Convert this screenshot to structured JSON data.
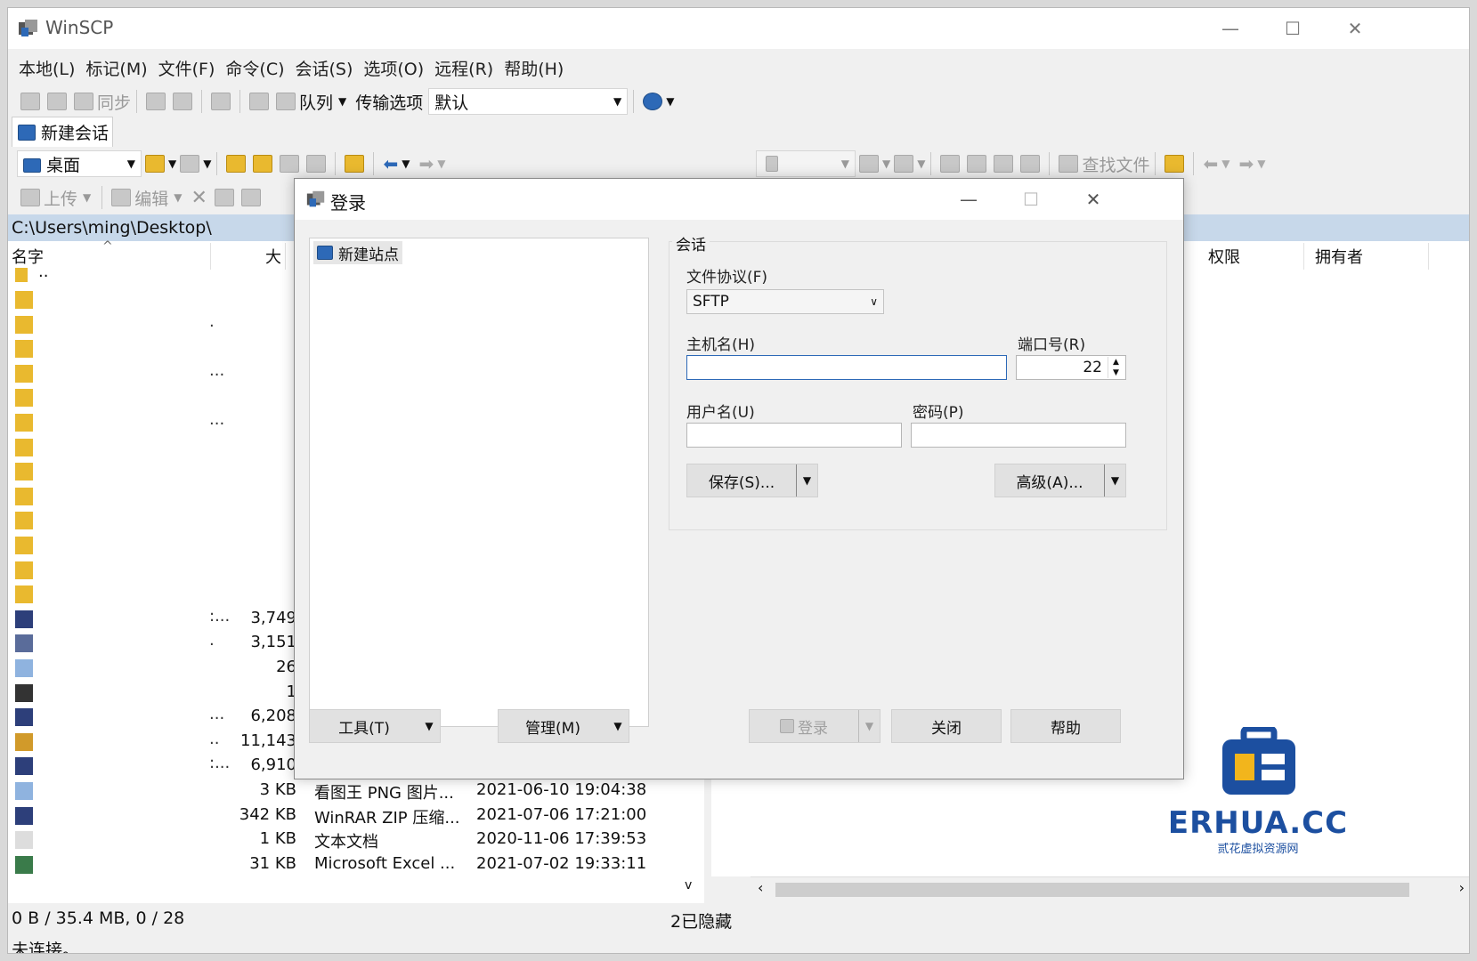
{
  "window": {
    "title": "WinSCP",
    "minimize": "—",
    "maximize": "☐",
    "close": "✕"
  },
  "menu": [
    "本地(L)",
    "标记(M)",
    "文件(F)",
    "命令(C)",
    "会话(S)",
    "选项(O)",
    "远程(R)",
    "帮助(H)"
  ],
  "toolbar": {
    "sync_label": "同步",
    "queue_label": "队列",
    "transfer_label": "传输选项",
    "transfer_value": "默认"
  },
  "tabs": {
    "new_session": "新建会话"
  },
  "local": {
    "location": "桌面",
    "upload_label": "上传",
    "edit_label": "编辑",
    "path": "C:\\Users\\ming\\Desktop\\",
    "col_name": "名字",
    "col_size": "大",
    "parent": "..",
    "rows": [
      {
        "dots": "",
        "size": "",
        "type": "",
        "date": ""
      },
      {
        "dots": ".",
        "size": "",
        "type": "",
        "date": ""
      },
      {
        "dots": "",
        "size": "",
        "type": "",
        "date": ""
      },
      {
        "dots": "...",
        "size": "",
        "type": "",
        "date": ""
      },
      {
        "dots": "",
        "size": "",
        "type": "",
        "date": ""
      },
      {
        "dots": "...",
        "size": "",
        "type": "",
        "date": ""
      },
      {
        "dots": "",
        "size": "",
        "type": "",
        "date": ""
      },
      {
        "dots": "",
        "size": "",
        "type": "",
        "date": ""
      },
      {
        "dots": "",
        "size": "",
        "type": "",
        "date": ""
      },
      {
        "dots": "",
        "size": "",
        "type": "",
        "date": ""
      },
      {
        "dots": "",
        "size": "",
        "type": "",
        "date": ""
      },
      {
        "dots": "",
        "size": "",
        "type": "",
        "date": ""
      },
      {
        "dots": "",
        "size": "",
        "type": "",
        "date": ""
      },
      {
        "dots": ":...",
        "size": "3,749",
        "type": "",
        "date": ""
      },
      {
        "dots": ".",
        "size": "3,151",
        "type": "",
        "date": ""
      },
      {
        "dots": "",
        "size": "26",
        "type": "",
        "date": ""
      },
      {
        "dots": "",
        "size": "1",
        "type": "",
        "date": ""
      },
      {
        "dots": "...",
        "size": "6,208",
        "type": "",
        "date": ""
      },
      {
        "dots": "..",
        "size": "11,143",
        "type": "",
        "date": ""
      },
      {
        "dots": ":...",
        "size": "6,910",
        "type": "",
        "date": ""
      },
      {
        "dots": "",
        "size": "3 KB",
        "type": "看图王 PNG 图片...",
        "date": "2021-06-10  19:04:38"
      },
      {
        "dots": "",
        "size": "342 KB",
        "type": "WinRAR ZIP 压缩...",
        "date": "2021-07-06  17:21:00"
      },
      {
        "dots": "",
        "size": "1 KB",
        "type": "文本文档",
        "date": "2020-11-06  17:39:53"
      },
      {
        "dots": "",
        "size": "31 KB",
        "type": "Microsoft Excel ...",
        "date": "2021-07-02  19:33:11"
      }
    ]
  },
  "remote": {
    "find_label": "查找文件",
    "col_perm": "权限",
    "col_owner": "拥有者"
  },
  "status": {
    "selection": "0 B / 35.4 MB,   0 / 28",
    "hidden": "2已隐藏",
    "connection": "未连接。"
  },
  "login": {
    "title": "登录",
    "site_new": "新建站点",
    "group_label": "会话",
    "protocol_label": "文件协议(F)",
    "protocol_value": "SFTP",
    "host_label": "主机名(H)",
    "host_value": "",
    "port_label": "端口号(R)",
    "port_value": "22",
    "user_label": "用户名(U)",
    "user_value": "",
    "password_label": "密码(P)",
    "password_value": "",
    "save_label": "保存(S)...",
    "advanced_label": "高级(A)...",
    "tools_label": "工具(T)",
    "manage_label": "管理(M)",
    "login_label": "登录",
    "close_label": "关闭",
    "help_label": "帮助"
  },
  "watermark": {
    "brand": "ERHUA.CC",
    "tagline": "贰花虚拟资源网"
  }
}
